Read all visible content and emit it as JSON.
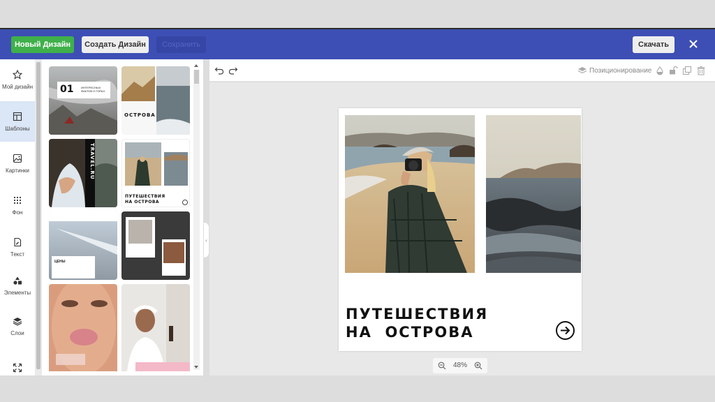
{
  "topbar": {
    "new_design": "Новый Дизайн",
    "create_design": "Создать Дизайн",
    "save": "Сохранить",
    "download": "Скачать"
  },
  "nav": [
    {
      "label": "Мой дизайн",
      "icon": "star-icon"
    },
    {
      "label": "Шаблоны",
      "icon": "templates-icon"
    },
    {
      "label": "Картинки",
      "icon": "image-icon"
    },
    {
      "label": "Фон",
      "icon": "dots-grid-icon"
    },
    {
      "label": "Текст",
      "icon": "text-file-icon"
    },
    {
      "label": "Элементы",
      "icon": "shapes-icon"
    },
    {
      "label": "Слои",
      "icon": "layers-icon"
    },
    {
      "label": "",
      "icon": "expand-icon"
    }
  ],
  "templates": {
    "t1_num": "01",
    "t1_text": "ИНТЕРЕСНЫХ ФАКТОВ О ГОРАХ",
    "t2_text": "ОСТРОВА",
    "t3_side": "TRAVEL.RU",
    "t4_text": "ПУТЕШЕСТВИЯ НА ОСТРОВА",
    "t5_text": "ЦЕНЫ"
  },
  "toolbar": {
    "positioning": "Позиционирование"
  },
  "canvas": {
    "line1": "ПУТЕШЕСТВИЯ",
    "line2": "НА  ОСТРОВА"
  },
  "zoom": {
    "value": "48%"
  },
  "colors": {
    "topbar": "#3d4fb5",
    "green": "#3fb04a",
    "active_nav": "#dbe6f6"
  }
}
